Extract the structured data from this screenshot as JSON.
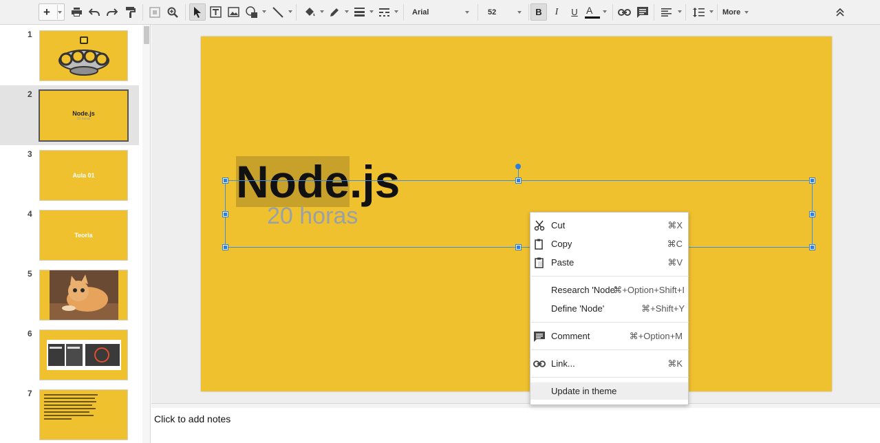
{
  "toolbar": {
    "font_name": "Arial",
    "font_size": "52",
    "more_label": "More",
    "text_color": "#000000",
    "icons": [
      "plus-icon",
      "print-icon",
      "undo-icon",
      "redo-icon",
      "paint-format-icon",
      "zoom-fit-icon",
      "zoom-icon",
      "select-cursor-icon",
      "text-box-icon",
      "image-icon",
      "shape-icon",
      "line-icon",
      "fill-color-icon",
      "border-color-icon",
      "border-weight-icon",
      "border-dash-icon",
      "bold-icon",
      "italic-icon",
      "underline-icon",
      "text-color-icon",
      "link-icon",
      "comment-icon",
      "align-icon",
      "line-spacing-icon",
      "collapse-icon"
    ]
  },
  "filmstrip": {
    "slides": [
      {
        "number": "1",
        "title": "",
        "subtitle": ""
      },
      {
        "number": "2",
        "title": "Node.js",
        "subtitle": "20 horas"
      },
      {
        "number": "3",
        "title": "Aula 01",
        "subtitle": ""
      },
      {
        "number": "4",
        "title": "Teoria",
        "subtitle": ""
      },
      {
        "number": "5",
        "title": "",
        "subtitle": ""
      },
      {
        "number": "6",
        "title": "",
        "subtitle": ""
      },
      {
        "number": "7",
        "title": "",
        "subtitle": ""
      }
    ]
  },
  "slide": {
    "title_selected": "Node",
    "title_rest": ".js",
    "subtitle": "20 horas",
    "background": "#f0c12f"
  },
  "notes": {
    "placeholder": "Click to add notes"
  },
  "context_menu": {
    "items": [
      {
        "label": "Cut",
        "shortcut": "⌘X",
        "icon": "cut-icon"
      },
      {
        "label": "Copy",
        "shortcut": "⌘C",
        "icon": "copy-icon"
      },
      {
        "label": "Paste",
        "shortcut": "⌘V",
        "icon": "paste-icon"
      },
      {
        "label": "Research 'Node'",
        "shortcut": "⌘+Option+Shift+I",
        "icon": ""
      },
      {
        "label": "Define 'Node'",
        "shortcut": "⌘+Shift+Y",
        "icon": ""
      },
      {
        "label": "Comment",
        "shortcut": "⌘+Option+M",
        "icon": "comment-icon"
      },
      {
        "label": "Link...",
        "shortcut": "⌘K",
        "icon": "link-icon"
      },
      {
        "label": "Update in theme",
        "shortcut": "",
        "icon": ""
      }
    ]
  }
}
